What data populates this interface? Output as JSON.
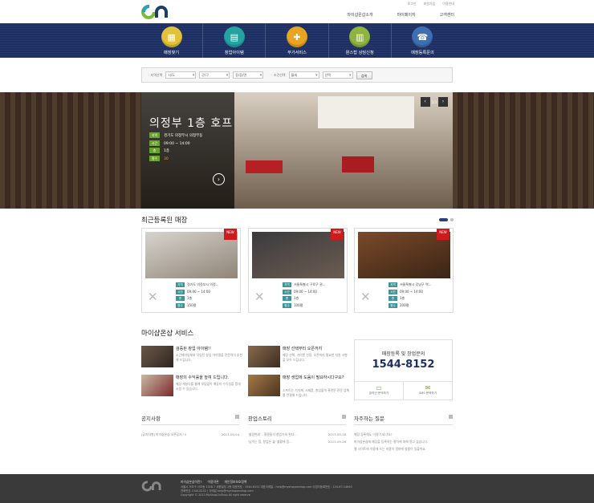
{
  "util_links": [
    "로그인",
    "회원가입",
    "이용안내"
  ],
  "top_nav": [
    "마이샵온샵소개",
    "마이페이지",
    "고객센터"
  ],
  "categories": [
    {
      "label": "매장찾기",
      "color": "#e0c23b",
      "icon": "store-icon"
    },
    {
      "label": "창업아이템",
      "color": "#24a3a0",
      "icon": "shop-icon"
    },
    {
      "label": "부가서비스",
      "color": "#e8a522",
      "icon": "gift-icon"
    },
    {
      "label": "원스탑 상담신청",
      "color": "#8fb33f",
      "icon": "document-icon"
    },
    {
      "label": "매장등록문의",
      "color": "#3e6fb0",
      "icon": "phone-icon"
    }
  ],
  "search": {
    "region_label": "· 지역선택",
    "region_sel": [
      "시/도",
      "군/구",
      "동/읍/면"
    ],
    "cond_label": "· 조건선택",
    "cond_sel": [
      "월세",
      "선택"
    ],
    "button": "검색"
  },
  "hero": {
    "title": "의정부 1층 호프",
    "rows": [
      {
        "tag": "지역",
        "text": "경기도 의정부시 의정부동"
      },
      {
        "tag": "시간",
        "text": "09:00 ~ 14:00"
      },
      {
        "tag": "층",
        "text": "1층"
      },
      {
        "tag": "평수",
        "text": "30"
      }
    ],
    "page": "1/3"
  },
  "recent": {
    "title": "최근등록된 매장",
    "cards": [
      {
        "badge": "NEW",
        "rows": [
          {
            "tag": "지역",
            "text": "경기도 의정부시 의정..."
          },
          {
            "tag": "시간",
            "text": "09:00 ~ 14:00"
          },
          {
            "tag": "층",
            "text": "1층"
          },
          {
            "tag": "평수",
            "text": "150평"
          }
        ]
      },
      {
        "badge": "NEW",
        "rows": [
          {
            "tag": "지역",
            "text": "서울특별시 구로구 권..."
          },
          {
            "tag": "시간",
            "text": "09:00 ~ 14:00"
          },
          {
            "tag": "층",
            "text": "1층"
          },
          {
            "tag": "평수",
            "text": "100평"
          }
        ]
      },
      {
        "badge": "NEW",
        "rows": [
          {
            "tag": "지역",
            "text": "서울특별시 강남구 역..."
          },
          {
            "tag": "시간",
            "text": "09:00 ~ 14:00"
          },
          {
            "tag": "층",
            "text": "1층"
          },
          {
            "tag": "평수",
            "text": "200평"
          }
        ]
      }
    ]
  },
  "services": {
    "title": "마이샵온샵 서비스",
    "items": [
      {
        "title": "검증된 창업 아이템!!",
        "desc": "시간제약업체와 작업된 창업 아이템을 전문적이 추천해 드립니다."
      },
      {
        "title": "매장 선택부터 오픈까지",
        "desc": "매장 선택, 가이텐 선정, 오픈까지 필요한 지원 사항을 모두 드립니다."
      },
      {
        "title": "매장의 수익률을 높여 드립니다.",
        "desc": "매장 게실다를 통해 부담없이 매장의 수익성을 증대시킬 수 있습니다."
      },
      {
        "title": "매장 생업에 도움이 필요하시다구요?",
        "desc": "소프트는 기자재, 시제품, 총임물의 관련된 전문 업체를 연결해 드립니다."
      }
    ]
  },
  "contact": {
    "title": "매장등록 및 창업문의",
    "phone": "1544-8152",
    "links": [
      "온라인 문의하기",
      "SMS 문의하기"
    ]
  },
  "boards": [
    {
      "title": "공지사항",
      "rows": [
        {
          "text": "[공지사항] 마이샵온샵 오픈공지 !!!",
          "date": "2013-09-04"
        }
      ]
    },
    {
      "title": "창업스토리",
      "rows": [
        {
          "text": "'불량현외' - 홍콩들식 창업가의 편다...",
          "date": "2013-09-28"
        },
        {
          "text": "'남주는 힘, 창업은 술' 불황에 음...",
          "date": "2013-09-28"
        }
      ]
    },
    {
      "title": "자주하는 질문",
      "rows": [
        {
          "text": "매장 등록해도 이용이 되나요?",
          "date": ""
        },
        {
          "text": "마이샵온샵에 매장을 등록하는 절차에 대해 알고 싶습니다.",
          "date": ""
        },
        {
          "text": "웹 사이트에 이용에 드는 비용이 얼마에 방법이 있을까요.",
          "date": ""
        }
      ]
    }
  ],
  "footer": {
    "links": [
      "마이샵온샵이란?",
      "이용약관",
      "개인정보보호정책"
    ],
    "lines": [
      "서울시 서초구 서초동 1328-7 세원빌딩 2층 대표번호 : 1544-8152 대표이메일 : help@myshoponshop.com 사업자등록번호 : 124-87-14640",
      "전화번호 1544-8152 | 이메일 help@myshoponshop.com",
      "Copyright © 2013 MyShopOnShop All right reserve"
    ]
  }
}
